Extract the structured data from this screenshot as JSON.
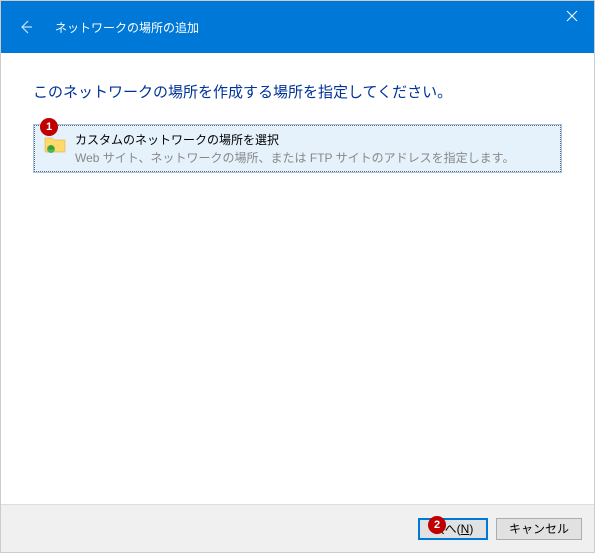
{
  "titlebar": {
    "title": "ネットワークの場所の追加"
  },
  "content": {
    "heading": "このネットワークの場所を作成する場所を指定してください。",
    "option": {
      "title": "カスタムのネットワークの場所を選択",
      "description": "Web サイト、ネットワークの場所、または FTP サイトのアドレスを指定します。"
    }
  },
  "footer": {
    "next_prefix": "次へ(",
    "next_hotkey": "N",
    "next_suffix": ")",
    "cancel": "キャンセル"
  },
  "annotations": {
    "badge1": "1",
    "badge2": "2"
  }
}
